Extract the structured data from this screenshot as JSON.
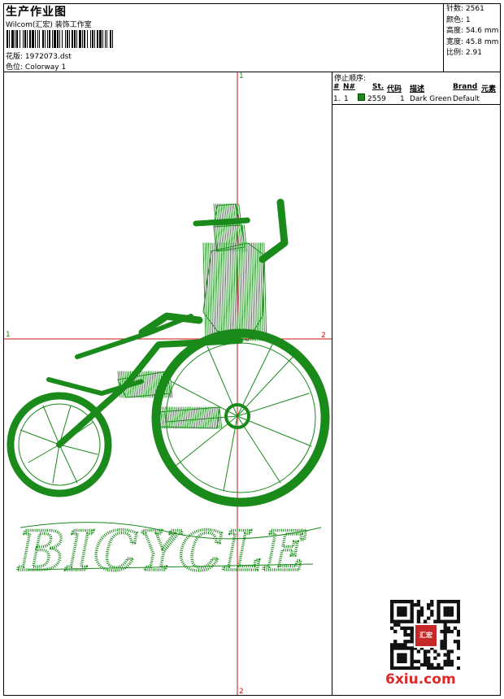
{
  "header": {
    "title": "生产作业图",
    "subtitle": "Wilcom(汇宏) 装饰工作室",
    "design_label": "花版:",
    "design_value": "1972073.dst",
    "colorway_label": "色位:",
    "colorway_value": "Colorway 1"
  },
  "stats": [
    {
      "label": "针数:",
      "value": "2561"
    },
    {
      "label": "颜色:",
      "value": "1"
    },
    {
      "label": "高度:",
      "value": "54.6 mm"
    },
    {
      "label": "宽度:",
      "value": "45.8 mm"
    },
    {
      "label": "比例:",
      "value": "2.91"
    }
  ],
  "stop_sequence": {
    "title": "停止顺序:",
    "columns": [
      "#",
      "N#",
      "St.",
      "代码",
      "描述",
      "Brand",
      "元素"
    ],
    "rows": [
      {
        "index": "1.",
        "n": "1",
        "color": "#1a8a1a",
        "stitches": "2559",
        "code": "1",
        "description": "Dark Green",
        "brand": "Default"
      }
    ]
  },
  "canvas": {
    "axis_top": "1",
    "axis_bottom": "2",
    "axis_left": "1",
    "axis_right": "2",
    "embroidery_text": "BICYCLE",
    "thread_color": "#1a8a1a",
    "axis_color": "#d01010",
    "axis_label_color": "#1a8a1a"
  },
  "watermark": {
    "text": "6xiu.com",
    "qr_badge": "汇宏"
  }
}
